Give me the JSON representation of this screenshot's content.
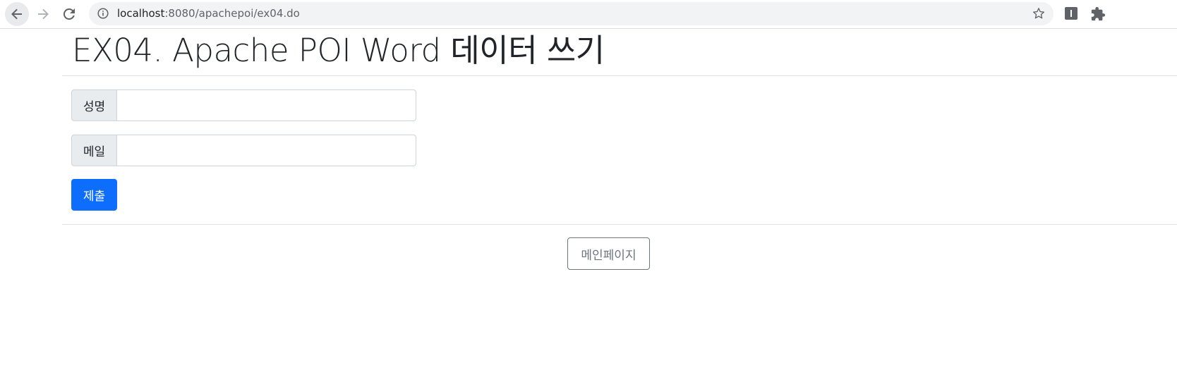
{
  "browser": {
    "url_host": "localhost",
    "url_path": ":8080/apachepoi/ex04.do"
  },
  "page": {
    "title": "EX04. Apache POI Word 데이터 쓰기"
  },
  "form": {
    "name_label": "성명",
    "name_value": "",
    "email_label": "메일",
    "email_value": "",
    "submit_label": "제출"
  },
  "footer": {
    "main_page_label": "메인페이지"
  },
  "colors": {
    "primary": "#0d6efd",
    "secondary": "#6c757d"
  },
  "icons": {
    "back": "back-arrow-icon",
    "forward": "forward-arrow-icon",
    "reload": "reload-icon",
    "info": "info-icon",
    "star": "star-icon",
    "extension": "extension-icon",
    "puzzle": "puzzle-icon"
  }
}
